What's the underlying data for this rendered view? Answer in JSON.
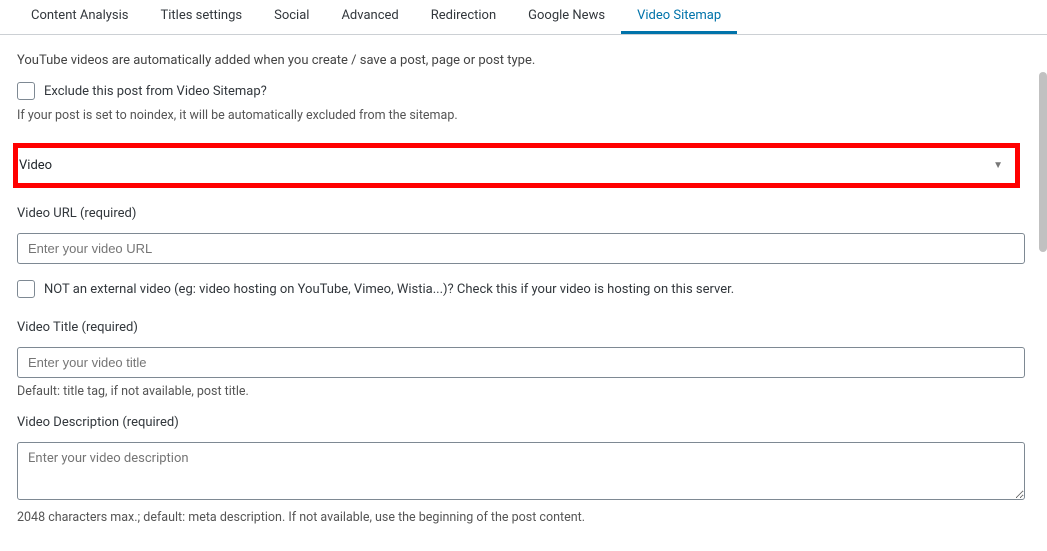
{
  "tabs": {
    "items": [
      {
        "label": "Content Analysis"
      },
      {
        "label": "Titles settings"
      },
      {
        "label": "Social"
      },
      {
        "label": "Advanced"
      },
      {
        "label": "Redirection"
      },
      {
        "label": "Google News"
      },
      {
        "label": "Video Sitemap"
      }
    ]
  },
  "intro": "YouTube videos are automatically added when you create / save a post, page or post type.",
  "exclude": {
    "label": "Exclude this post from Video Sitemap?",
    "helper": "If your post is set to noindex, it will be automatically excluded from the sitemap."
  },
  "video_select": {
    "selected": "Video"
  },
  "video_url": {
    "label": "Video URL (required)",
    "placeholder": "Enter your video URL"
  },
  "not_external": {
    "label": "NOT an external video (eg: video hosting on YouTube, Vimeo, Wistia...)? Check this if your video is hosting on this server."
  },
  "video_title": {
    "label": "Video Title (required)",
    "placeholder": "Enter your video title",
    "helper": "Default: title tag, if not available, post title."
  },
  "video_description": {
    "label": "Video Description (required)",
    "placeholder": "Enter your video description",
    "helper": "2048 characters max.; default: meta description. If not available, use the beginning of the post content."
  }
}
